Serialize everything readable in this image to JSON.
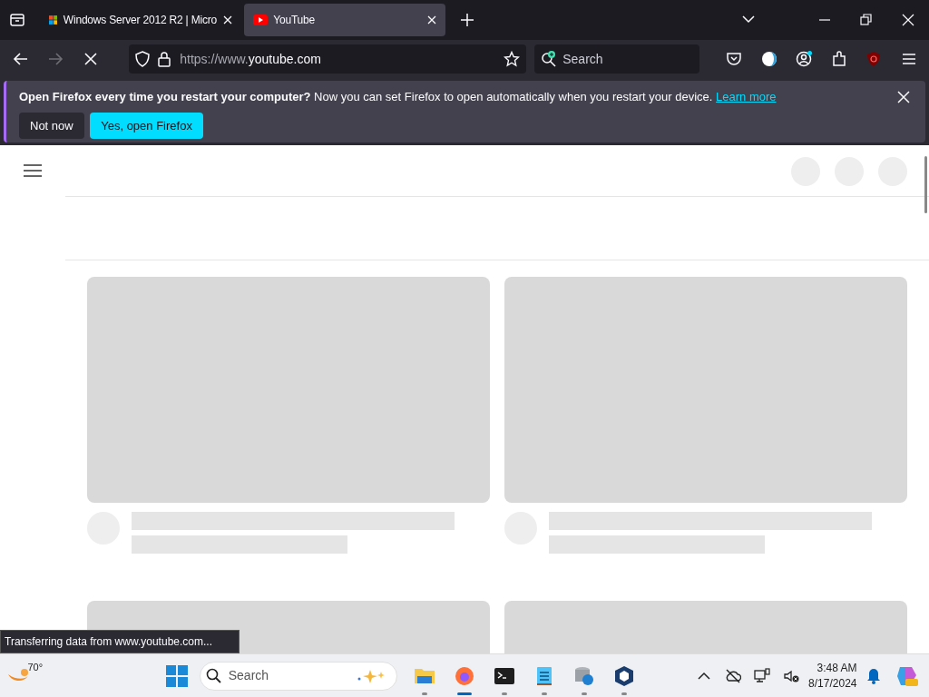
{
  "tabs": [
    {
      "title": "Windows Server 2012 R2 | Micro",
      "kind": "windows",
      "selected": false
    },
    {
      "title": "YouTube",
      "kind": "youtube",
      "selected": true
    }
  ],
  "address_bar": {
    "url_prefix": "https://www.",
    "url_domain": "youtube.com",
    "loading": true
  },
  "search": {
    "placeholder": "Search"
  },
  "notification": {
    "message": "**Open Firefox every time you restart your computer?** Now you can set Firefox to open automatically when you restart your device.",
    "link": "Learn more",
    "buttons": [
      {
        "label": "Not now",
        "kind": "secondary"
      },
      {
        "label": "Yes, open Firefox",
        "kind": "primary"
      }
    ]
  },
  "status_text": "Transferring data from www.youtube.com...",
  "taskbar": {
    "weather": "70°",
    "search_placeholder": "Search",
    "apps": [
      {
        "kind": "folder",
        "active": false
      },
      {
        "kind": "firefox",
        "active": true
      },
      {
        "kind": "terminal",
        "active": false
      },
      {
        "kind": "notepad",
        "active": false
      },
      {
        "kind": "database",
        "active": false
      },
      {
        "kind": "virtualbox",
        "active": false
      }
    ],
    "time": "3:48 AM",
    "date": "8/17/2024"
  }
}
